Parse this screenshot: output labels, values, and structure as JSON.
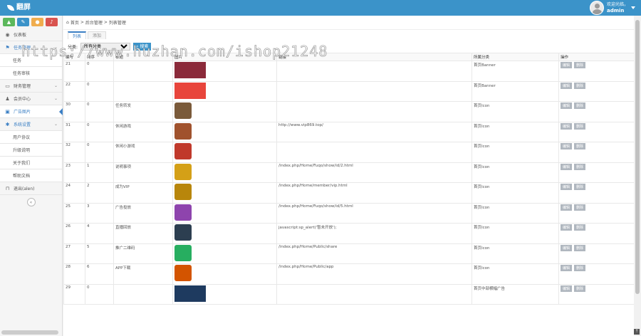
{
  "app": {
    "logo_text": "翻屏"
  },
  "user": {
    "greeting": "欢迎光临，",
    "name": "admin"
  },
  "quick_buttons": [
    {
      "icon": "chart-icon",
      "color": "#5cb85c",
      "glyph": "▲"
    },
    {
      "icon": "pencil-icon",
      "color": "#3b93c9",
      "glyph": "✎"
    },
    {
      "icon": "users-icon",
      "color": "#f0ad4e",
      "glyph": "●"
    },
    {
      "icon": "bell-icon",
      "color": "#d9534f",
      "glyph": "♪"
    }
  ],
  "sidebar": {
    "dashboard": "仪表板",
    "task_mgmt": "任务管理",
    "task_sub1": "任务",
    "task_sub2": "任务审核",
    "finance": "财务管理",
    "member": "会员中心",
    "ads": "广告图片",
    "system": "系统设置",
    "sys_sub1": "用户协议",
    "sys_sub2": "升级说明",
    "sys_sub3": "关于我们",
    "sys_sub4": "帮助文档",
    "logout": "退出(alen)"
  },
  "breadcrumb": [
    "首页",
    "后台管理",
    "列表管理"
  ],
  "tabs": [
    "列表",
    "添加"
  ],
  "filter": {
    "label": "分类:",
    "selected": "所有分类",
    "button": "搜索"
  },
  "table": {
    "headers": [
      "编号",
      "排序",
      "标题",
      "图片",
      "链接",
      "所属分类",
      "操作"
    ],
    "rows": [
      {
        "id": "21",
        "sort": "0",
        "title": "",
        "img": "banner1",
        "link": "",
        "category": "首页Banner"
      },
      {
        "id": "22",
        "sort": "0",
        "title": "",
        "img": "banner2",
        "link": "",
        "category": "首页Banner"
      },
      {
        "id": "30",
        "sort": "0",
        "title": "任务转发",
        "img": "icon1",
        "link": "",
        "category": "首页Icon"
      },
      {
        "id": "31",
        "sort": "0",
        "title": "休闲游戏",
        "img": "icon2",
        "link": "http://www.vip869.top/",
        "category": "首页Icon"
      },
      {
        "id": "32",
        "sort": "0",
        "title": "休闲小游戏",
        "img": "icon3",
        "link": "",
        "category": "首页Icon"
      },
      {
        "id": "23",
        "sort": "1",
        "title": "说明事项",
        "img": "icon4",
        "link": "/index.php/Home/Fuqo/show/id/2.html",
        "category": "首页Icon"
      },
      {
        "id": "24",
        "sort": "2",
        "title": "成为VIP",
        "img": "icon5",
        "link": "/index.php/Home/member/vip.html",
        "category": "首页Icon"
      },
      {
        "id": "25",
        "sort": "3",
        "title": "广告投放",
        "img": "icon6",
        "link": "/index.php/Home/Fuqo/show/id/5.html",
        "category": "首页Icon"
      },
      {
        "id": "26",
        "sort": "4",
        "title": "直播回放",
        "img": "icon7",
        "link": "javascript:sp_alert('暂未开放');",
        "category": "首页Icon"
      },
      {
        "id": "27",
        "sort": "5",
        "title": "推广二维码",
        "img": "icon8",
        "link": "/index.php/Home/Public/share",
        "category": "首页Icon"
      },
      {
        "id": "28",
        "sort": "6",
        "title": "APP下载",
        "img": "icon9",
        "link": "/index.php/Home/Public/app",
        "category": "首页Icon"
      },
      {
        "id": "29",
        "sort": "0",
        "title": "",
        "img": "banner3",
        "link": "",
        "category": "首页中部横幅广告"
      }
    ],
    "edit_label": "编辑",
    "delete_label": "删除"
  },
  "watermark": "https://www.huzhan.com/ishop21248",
  "colors": {
    "banner1": "#8b2a3a",
    "banner2": "#e8453c",
    "banner3": "#1e3a5f",
    "icon1": "#7a5a3a",
    "icon2": "#a0522d",
    "icon3": "#c0392b",
    "icon4": "#d4a017",
    "icon5": "#b8860b",
    "icon6": "#8e44ad",
    "icon7": "#2c3e50",
    "icon8": "#27ae60",
    "icon9": "#d35400"
  }
}
